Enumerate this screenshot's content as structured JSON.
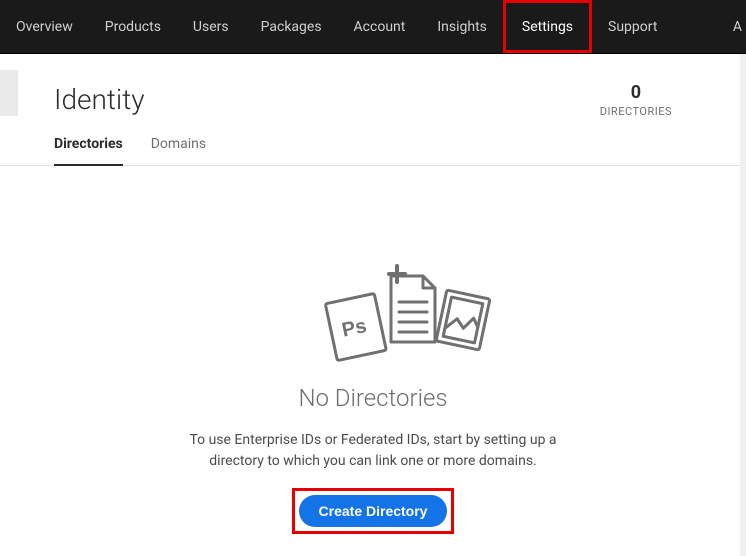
{
  "nav": {
    "items": [
      {
        "label": "Overview"
      },
      {
        "label": "Products"
      },
      {
        "label": "Users"
      },
      {
        "label": "Packages"
      },
      {
        "label": "Account"
      },
      {
        "label": "Insights"
      },
      {
        "label": "Settings",
        "highlighted": true
      },
      {
        "label": "Support"
      },
      {
        "label": "A"
      }
    ]
  },
  "page": {
    "title": "Identity"
  },
  "stats": {
    "count": "0",
    "label": "DIRECTORIES"
  },
  "subtabs": {
    "items": [
      {
        "label": "Directories",
        "active": true
      },
      {
        "label": "Domains"
      }
    ]
  },
  "empty": {
    "title": "No Directories",
    "description": "To use Enterprise IDs or Federated IDs, start by setting up a directory to which you can link one or more domains.",
    "cta": "Create Directory"
  }
}
